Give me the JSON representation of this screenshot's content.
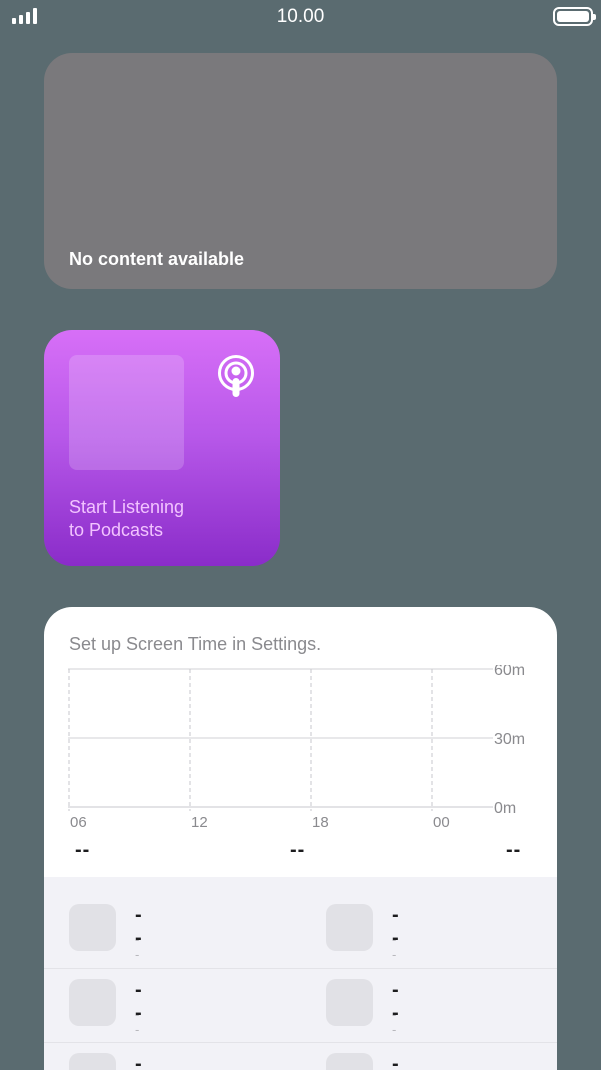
{
  "status_bar": {
    "time": "10.00"
  },
  "widgets": {
    "empty": {
      "message": "No content available"
    },
    "podcasts": {
      "line1": "Start Listening",
      "line2": "to Podcasts",
      "icon": "podcasts-icon"
    },
    "screen_time": {
      "heading": "Set up Screen Time in Settings.",
      "summary": [
        "--",
        "--",
        "--"
      ],
      "apps": [
        {
          "value": "--",
          "sub": "--"
        },
        {
          "value": "--",
          "sub": "--"
        },
        {
          "value": "--",
          "sub": "--"
        },
        {
          "value": "--",
          "sub": "--"
        },
        {
          "value": "--",
          "sub": "--"
        },
        {
          "value": "--",
          "sub": "--"
        }
      ]
    }
  },
  "chart_data": {
    "type": "bar",
    "categories": [
      "06",
      "12",
      "18",
      "00"
    ],
    "series": [],
    "ylim": [
      0,
      60
    ],
    "y_ticks": [
      "0m",
      "30m",
      "60m"
    ],
    "xlabel": "",
    "ylabel": ""
  }
}
